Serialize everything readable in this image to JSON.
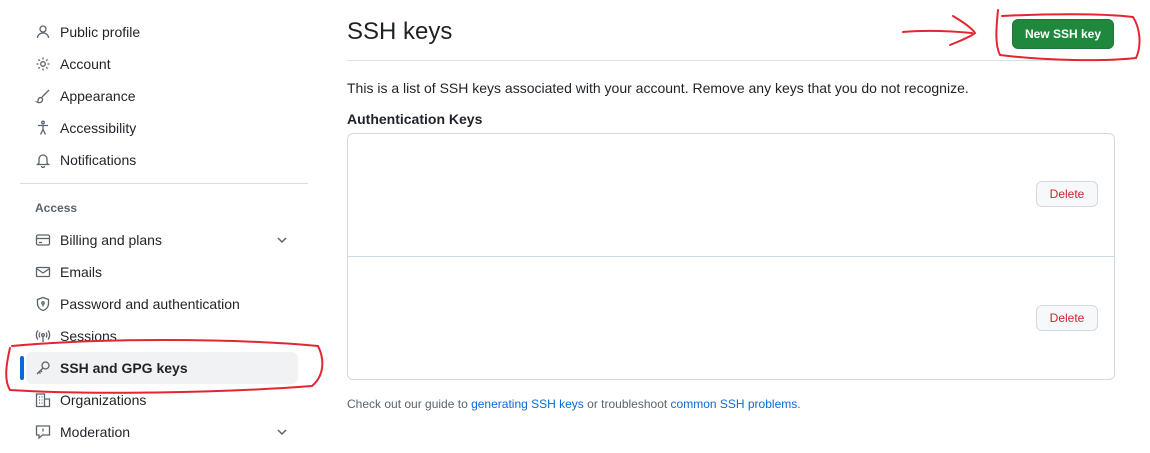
{
  "sidebar": {
    "top_items": [
      {
        "label": "Public profile",
        "icon": "person-icon"
      },
      {
        "label": "Account",
        "icon": "gear-icon"
      },
      {
        "label": "Appearance",
        "icon": "paintbrush-icon"
      },
      {
        "label": "Accessibility",
        "icon": "accessibility-icon"
      },
      {
        "label": "Notifications",
        "icon": "bell-icon"
      }
    ],
    "access_label": "Access",
    "access_items": [
      {
        "label": "Billing and plans",
        "icon": "credit-card-icon",
        "expandable": true
      },
      {
        "label": "Emails",
        "icon": "mail-icon"
      },
      {
        "label": "Password and authentication",
        "icon": "shield-lock-icon"
      },
      {
        "label": "Sessions",
        "icon": "broadcast-icon"
      },
      {
        "label": "SSH and GPG keys",
        "icon": "key-icon",
        "active": true
      },
      {
        "label": "Organizations",
        "icon": "organization-icon"
      },
      {
        "label": "Moderation",
        "icon": "report-icon",
        "expandable": true
      }
    ]
  },
  "main": {
    "title": "SSH keys",
    "new_key_button": "New SSH key",
    "description": "This is a list of SSH keys associated with your account. Remove any keys that you do not recognize.",
    "section_title": "Authentication Keys",
    "keys": [
      {
        "delete_label": "Delete"
      },
      {
        "delete_label": "Delete"
      }
    ],
    "footer": {
      "prefix": "Check out our guide to ",
      "link1": "generating SSH keys",
      "middle": " or troubleshoot ",
      "link2": "common SSH problems",
      "suffix": "."
    }
  },
  "colors": {
    "accent": "#0969da",
    "primary_button": "#1f883d",
    "danger": "#cf222e",
    "annotation": "#e3262f"
  }
}
